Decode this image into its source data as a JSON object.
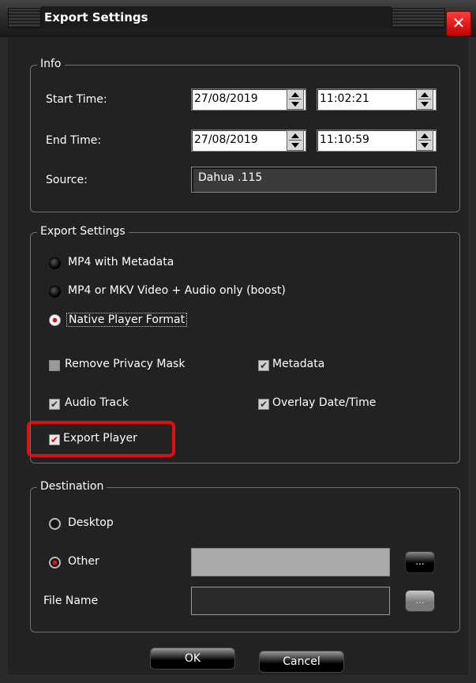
{
  "window": {
    "title": "Export Settings",
    "close_symbol": "✕"
  },
  "info": {
    "legend": "Info",
    "start_time_label": "Start Time:",
    "start_date": "27/08/2019",
    "start_time": "11:02:21",
    "end_time_label": "End Time:",
    "end_date": "27/08/2019",
    "end_time": "11:10:59",
    "source_label": "Source:",
    "source_value": "Dahua .115"
  },
  "export_settings": {
    "legend": "Export Settings",
    "format_options": [
      {
        "label": "MP4 with Metadata",
        "selected": false
      },
      {
        "label": "MP4 or MKV Video + Audio only (boost)",
        "selected": false
      },
      {
        "label": "Native Player Format",
        "selected": true
      }
    ],
    "checkboxes": {
      "remove_privacy_mask": {
        "label": "Remove Privacy Mask",
        "checked": false
      },
      "metadata": {
        "label": "Metadata",
        "checked": true
      },
      "audio_track": {
        "label": "Audio Track",
        "checked": true
      },
      "overlay_datetime": {
        "label": "Overlay Date/Time",
        "checked": true
      },
      "export_player": {
        "label": "Export Player",
        "checked": true
      }
    },
    "check_mark": "✔"
  },
  "destination": {
    "legend": "Destination",
    "desktop_label": "Desktop",
    "other_label": "Other",
    "selected": "Other",
    "other_path": "",
    "browse_label": "...",
    "file_name_label": "File Name",
    "file_name_value": "",
    "file_browse_label": "..."
  },
  "buttons": {
    "ok": "OK",
    "cancel": "Cancel"
  },
  "colors": {
    "background": "#222222",
    "highlight": "#e01010",
    "close_button": "#e01010"
  }
}
